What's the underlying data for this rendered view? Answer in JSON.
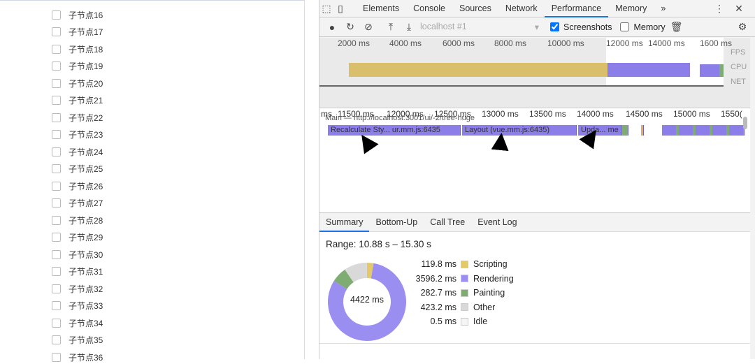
{
  "tree": {
    "items": [
      "子节点16",
      "子节点17",
      "子节点18",
      "子节点19",
      "子节点20",
      "子节点21",
      "子节点22",
      "子节点23",
      "子节点24",
      "子节点25",
      "子节点26",
      "子节点27",
      "子节点28",
      "子节点29",
      "子节点30",
      "子节点31",
      "子节点32",
      "子节点33",
      "子节点34",
      "子节点35",
      "子节点36"
    ]
  },
  "devtools": {
    "tabs": [
      "Elements",
      "Console",
      "Sources",
      "Network",
      "Performance",
      "Memory"
    ],
    "active_tab": "Performance",
    "more": "»",
    "toolbar": {
      "url": "localhost #1",
      "screenshots_label": "Screenshots",
      "screenshots_checked": true,
      "memory_label": "Memory",
      "memory_checked": false
    },
    "overview_ticks": [
      "2000 ms",
      "4000 ms",
      "6000 ms",
      "8000 ms",
      "10000 ms",
      "12000 ms",
      "14000 ms",
      "1600",
      "ms"
    ],
    "overview_labels": [
      "FPS",
      "CPU",
      "NET"
    ],
    "flame_ticks": [
      "ms",
      "11500 ms",
      "12000 ms",
      "12500 ms",
      "13000 ms",
      "13500 ms",
      "14000 ms",
      "14500 ms",
      "15000 ms",
      "1550("
    ],
    "main_track": "Main — http://localhost:3001/ui/-2/tree-huge",
    "flame_bars": [
      "Recalculate Sty... ur.mm.js:6435",
      "Layout (vue.mm.js:6435)",
      "Upda... me"
    ],
    "bottom_tabs": [
      "Summary",
      "Bottom-Up",
      "Call Tree",
      "Event Log"
    ],
    "range": "Range: 10.88 s – 15.30 s",
    "total": "4422 ms",
    "summary": [
      {
        "value": "119.8 ms",
        "ms": 119.8,
        "label": "Scripting",
        "color": "#e4c96a"
      },
      {
        "value": "3596.2 ms",
        "ms": 3596.2,
        "label": "Rendering",
        "color": "#9a8ef0"
      },
      {
        "value": "282.7 ms",
        "ms": 282.7,
        "label": "Painting",
        "color": "#7fac72"
      },
      {
        "value": "423.2 ms",
        "ms": 423.2,
        "label": "Other",
        "color": "#d9d9d9"
      },
      {
        "value": "0.5 ms",
        "ms": 0.5,
        "label": "Idle",
        "color": "#f5f5f5"
      }
    ],
    "annotation_color": "#e8141b"
  }
}
